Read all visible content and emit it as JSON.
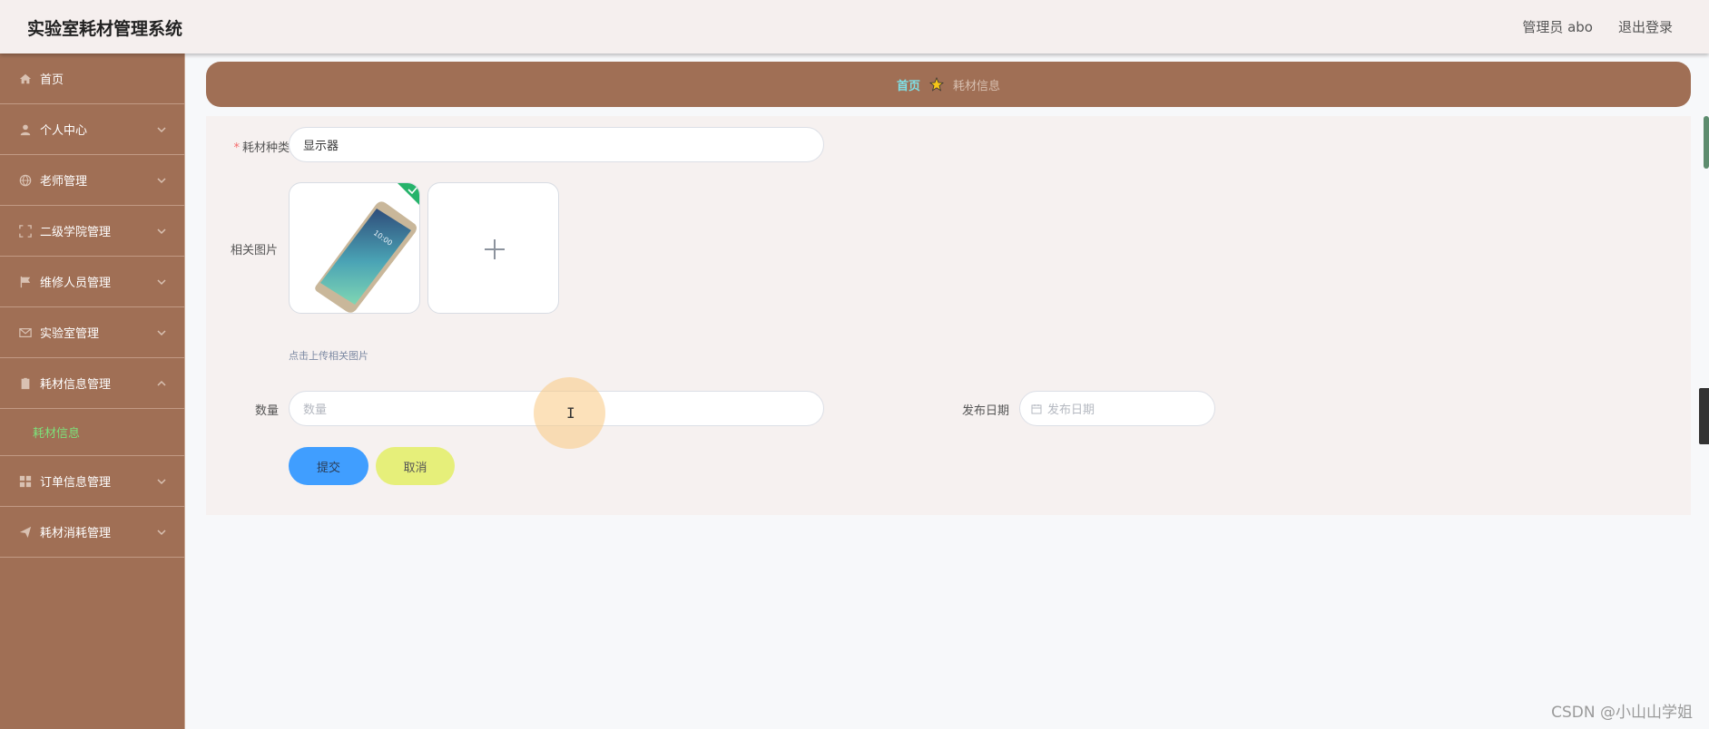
{
  "header": {
    "app_title": "实验室耗材管理系统",
    "user_label": "管理员 abo",
    "logout_label": "退出登录"
  },
  "sidebar": {
    "items": [
      {
        "label": "首页",
        "icon": "home-icon",
        "expandable": false
      },
      {
        "label": "个人中心",
        "icon": "user-icon",
        "expandable": true
      },
      {
        "label": "老师管理",
        "icon": "globe-icon",
        "expandable": true
      },
      {
        "label": "二级学院管理",
        "icon": "frame-icon",
        "expandable": true
      },
      {
        "label": "维修人员管理",
        "icon": "flag-icon",
        "expandable": true
      },
      {
        "label": "实验室管理",
        "icon": "mail-icon",
        "expandable": true
      },
      {
        "label": "耗材信息管理",
        "icon": "clipboard-icon",
        "expandable": true,
        "expanded": true
      },
      {
        "label": "订单信息管理",
        "icon": "grid-icon",
        "expandable": true
      },
      {
        "label": "耗材消耗管理",
        "icon": "send-icon",
        "expandable": true
      }
    ],
    "active_sub_item": "耗材信息"
  },
  "breadcrumb": {
    "home": "首页",
    "current": "耗材信息"
  },
  "form": {
    "category_label": "耗材种类",
    "category_value": "显示器",
    "images_label": "相关图片",
    "upload_hint": "点击上传相关图片",
    "quantity_label": "数量",
    "quantity_placeholder": "数量",
    "date_label": "发布日期",
    "date_placeholder": "发布日期",
    "submit_label": "提交",
    "cancel_label": "取消"
  },
  "watermark": "CSDN @小山山学姐",
  "colors": {
    "sidebar_bg": "#a06f55",
    "active_sub": "#7de07a",
    "submit": "#409eff",
    "cancel": "#e6ef7a",
    "breadcrumb_home": "#7fe0e6"
  }
}
